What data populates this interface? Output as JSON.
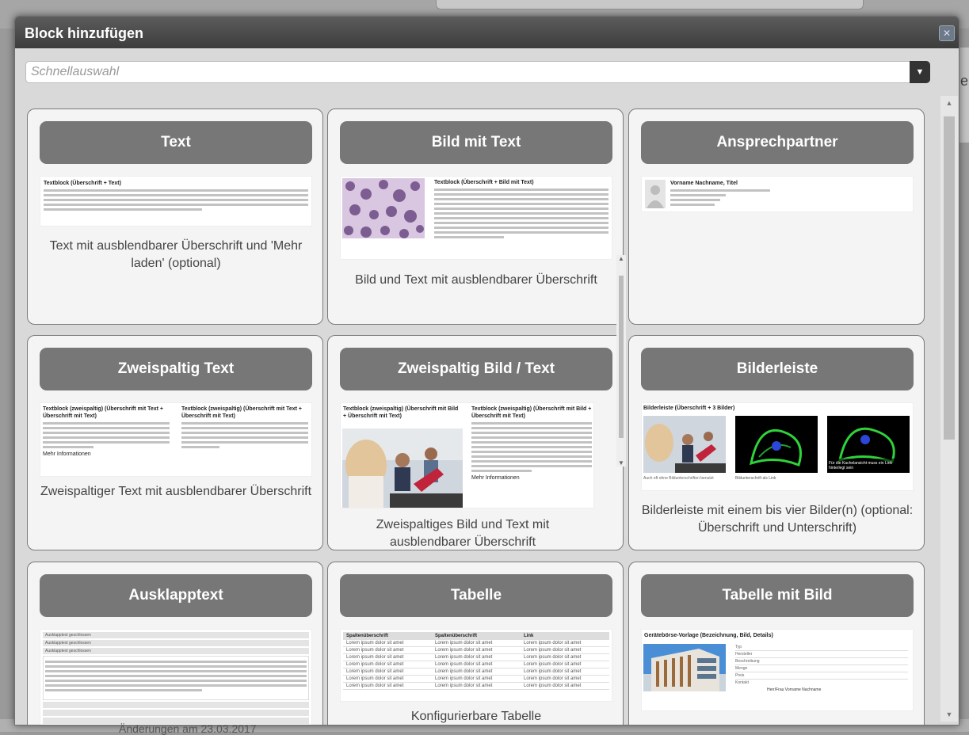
{
  "dialog": {
    "title": "Block hinzufügen",
    "close_icon": "close-icon",
    "search_placeholder": "Schnellauswahl",
    "search_value": ""
  },
  "background": {
    "side_letter": "e",
    "bottom_text": "Änderungen am 23.03.2017"
  },
  "tiles": [
    {
      "header": "Text",
      "description": "Text mit ausblendbarer Überschrift und 'Mehr laden' (optional)",
      "preview_title": "Textblock (Überschrift + Text)"
    },
    {
      "header": "Bild mit Text",
      "description": "Bild und Text mit ausblendbarer Überschrift",
      "preview_title": "Textblock (Überschrift + Bild mit Text)"
    },
    {
      "header": "Ansprechpartner",
      "description": "",
      "preview_title": "Vorname Nachname, Titel"
    },
    {
      "header": "Zweispaltig Text",
      "description": "Zweispaltiger Text mit ausblendbarer Überschrift",
      "preview_title": "Textblock (zweispaltig) (Überschrift mit Text + Überschrift mit Text)",
      "preview_link": "Mehr Informationen"
    },
    {
      "header": "Zweispaltig Bild / Text",
      "description": "Zweispaltiges Bild und Text mit ausblendbarer Überschrift",
      "preview_title_left": "Textblock (zweispaltig) (Überschrift mit Bild + Überschrift mit Text)",
      "preview_title_right": "Textblock (zweispaltig) (Überschrift mit Bild + Überschrift mit Text)",
      "preview_link": "Mehr Informationen"
    },
    {
      "header": "Bilderleiste",
      "description": "Bilderleiste mit einem bis vier Bilder(n) (optional: Überschrift und Unterschrift)",
      "preview_title": "Bilderleiste (Überschrift + 3 Bilder)",
      "preview_caption_1": "Auch oft ohne Bildunterschriften benutzt",
      "preview_caption_2": "Bildunterschrift als Link",
      "preview_overlay": "Für die Kachelansicht muss ein Link hinterlegt sein"
    },
    {
      "header": "Ausklapptext",
      "description": "",
      "preview_rows": [
        "Ausklapptext geschlossen",
        "Ausklapptext geschlossen",
        "Ausklapptext geschlossen"
      ]
    },
    {
      "header": "Tabelle",
      "description": "Konfigurierbare Tabelle",
      "preview_columns": [
        "Spaltenüberschrift",
        "Spaltenüberschrift",
        "Link"
      ],
      "preview_cell": "Lorem ipsum dolor sit amet"
    },
    {
      "header": "Tabelle mit Bild",
      "description": "",
      "preview_title": "Gerätebörse-Vorlage (Bezeichnung, Bild, Details)",
      "preview_fields": [
        "Typ",
        "Hersteller",
        "Beschreibung",
        "Menge",
        "Preis",
        "Kontakt"
      ],
      "preview_contact": "Herr/Frau Vorname Nachname"
    }
  ],
  "colors": {
    "titlebar": "#4a4a4a",
    "tile_header": "#777777",
    "tile_bg": "#f4f4f4",
    "dialog_bg": "#d9d9d9"
  }
}
